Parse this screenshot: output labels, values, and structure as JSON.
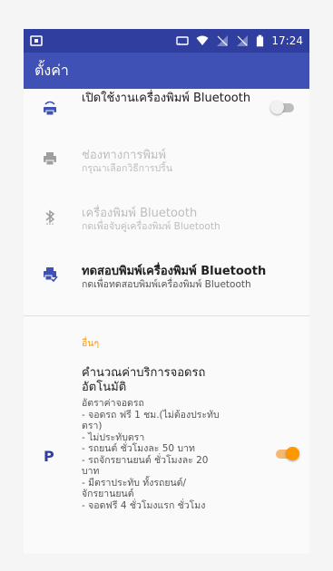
{
  "status_bar": {
    "time": "17:24"
  },
  "app_bar": {
    "title": "ตั้งค่า"
  },
  "settings": {
    "enable_bt_printer": {
      "title": "เปิดใช้งานเครื่องพิมพ์ Bluetooth",
      "enabled": false
    },
    "print_channel": {
      "title": "ช่องทางการพิมพ์",
      "summary": "กรุณาเลือกวิธีการปริ้น"
    },
    "bt_printer": {
      "title": "เครื่องพิมพ์ Bluetooth",
      "summary": "กดเพื่อจับคู่เครื่องพิมพ์ Bluetooth"
    },
    "test_print": {
      "title": "ทดสอบพิมพ์เครื่องพิมพ์ Bluetooth",
      "summary": "กดเพื่อทดสอบพิมพ์เครื่องพิมพ์ Bluetooth"
    },
    "other_category": "อื่นๆ",
    "parking_fee": {
      "icon_letter": "P",
      "title": "คำนวณค่าบริการจอดรถ\nอัตโนมัติ",
      "description": "อัตราค่าจอดรถ\n - จอดรถ ฟรี 1 ชม.(ไม่ต้องประทับ\nตรา)\n - ไม่ประทับตรา\n          - รถยนต์ ชั่วโมงละ 50 บาท\n          - รถจักรยานยนต์ ชั่วโมงละ 20\nบาท\n - มีตราประทับ ทั้งรถยนต์/\nจักรยานยนต์\n          - จอดฟรี 4 ชั่วโมงแรก ชั่วโมง",
      "enabled": true
    }
  },
  "colors": {
    "status_bar": "#303f9f",
    "app_bar": "#3f51b5",
    "accent": "#ff9800",
    "icon": "#3f51b5"
  }
}
